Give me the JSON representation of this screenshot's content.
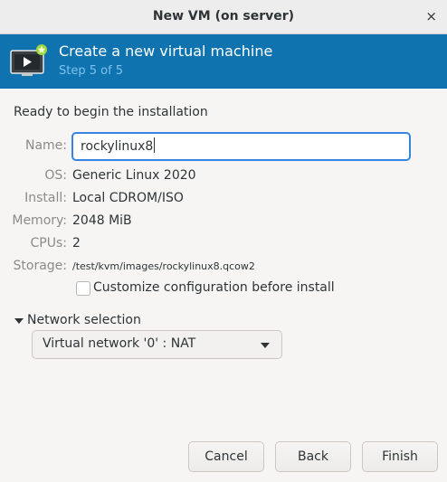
{
  "window": {
    "title": "New VM (on server)",
    "close_glyph": "×"
  },
  "banner": {
    "heading": "Create a new virtual machine",
    "step": "Step 5 of 5",
    "icon": "virtual-machine-icon",
    "colors": {
      "background": "#0f73b0",
      "step_text": "#7fc2ee"
    }
  },
  "summary": {
    "ready_text": "Ready to begin the installation",
    "name": {
      "label": "Name:",
      "value": "rockylinux8"
    },
    "os": {
      "label": "OS:",
      "value": "Generic Linux 2020"
    },
    "install": {
      "label": "Install:",
      "value": "Local CDROM/ISO"
    },
    "memory": {
      "label": "Memory:",
      "value": "2048 MiB"
    },
    "cpus": {
      "label": "CPUs:",
      "value": "2"
    },
    "storage": {
      "label": "Storage:",
      "value": "/test/kvm/images/rockylinux8.qcow2"
    }
  },
  "customize": {
    "label": "Customize configuration before install",
    "checked": false
  },
  "network": {
    "expander_label": "Network selection",
    "expanded": true,
    "selected": "Virtual network '0' : NAT"
  },
  "buttons": {
    "cancel": "Cancel",
    "back": "Back",
    "finish": "Finish"
  },
  "colors": {
    "focus": "#3584e4"
  }
}
